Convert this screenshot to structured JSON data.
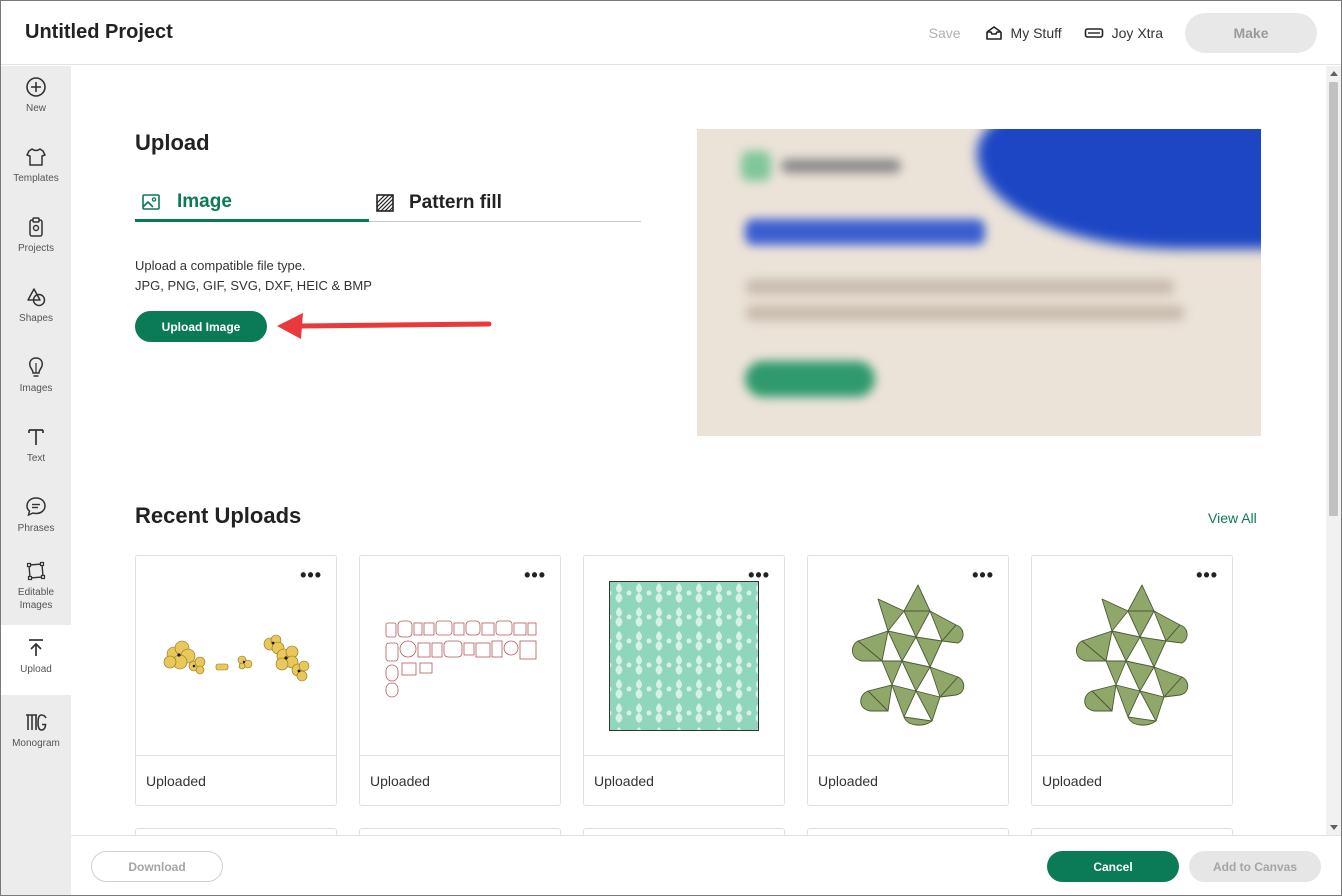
{
  "header": {
    "title": "Untitled Project",
    "save_label": "Save",
    "my_stuff_label": "My Stuff",
    "joy_xtra_label": "Joy Xtra",
    "make_label": "Make"
  },
  "sidebar": {
    "items": [
      {
        "label": "New",
        "icon": "plus-circle-icon"
      },
      {
        "label": "Templates",
        "icon": "shirt-icon"
      },
      {
        "label": "Projects",
        "icon": "projects-icon"
      },
      {
        "label": "Shapes",
        "icon": "shapes-icon"
      },
      {
        "label": "Images",
        "icon": "lightbulb-icon"
      },
      {
        "label": "Text",
        "icon": "text-icon"
      },
      {
        "label": "Phrases",
        "icon": "speech-bubble-icon"
      },
      {
        "label": "Editable Images",
        "icon": "editable-images-icon"
      },
      {
        "label": "Upload",
        "icon": "upload-icon",
        "active": true
      },
      {
        "label": "Monogram",
        "icon": "monogram-icon"
      }
    ]
  },
  "upload": {
    "title": "Upload",
    "tabs": [
      {
        "label": "Image",
        "active": true
      },
      {
        "label": "Pattern fill",
        "active": false
      }
    ],
    "description_line1": "Upload a compatible file type.",
    "description_line2": "JPG, PNG, GIF, SVG, DXF, HEIC & BMP",
    "button_label": "Upload Image"
  },
  "recent": {
    "title": "Recent Uploads",
    "view_all": "View All",
    "cards": [
      {
        "label": "Uploaded",
        "thumb": "yellow-flowers"
      },
      {
        "label": "Uploaded",
        "thumb": "red-outline-pieces"
      },
      {
        "label": "Uploaded",
        "thumb": "mint-pattern"
      },
      {
        "label": "Uploaded",
        "thumb": "green-polyhedron"
      },
      {
        "label": "Uploaded",
        "thumb": "green-polyhedron"
      }
    ]
  },
  "footer": {
    "download_label": "Download",
    "cancel_label": "Cancel",
    "add_label": "Add to Canvas"
  },
  "colors": {
    "accent": "#0b7a56",
    "annotation_arrow": "#e8393b",
    "sidebar_bg": "#ececec"
  }
}
